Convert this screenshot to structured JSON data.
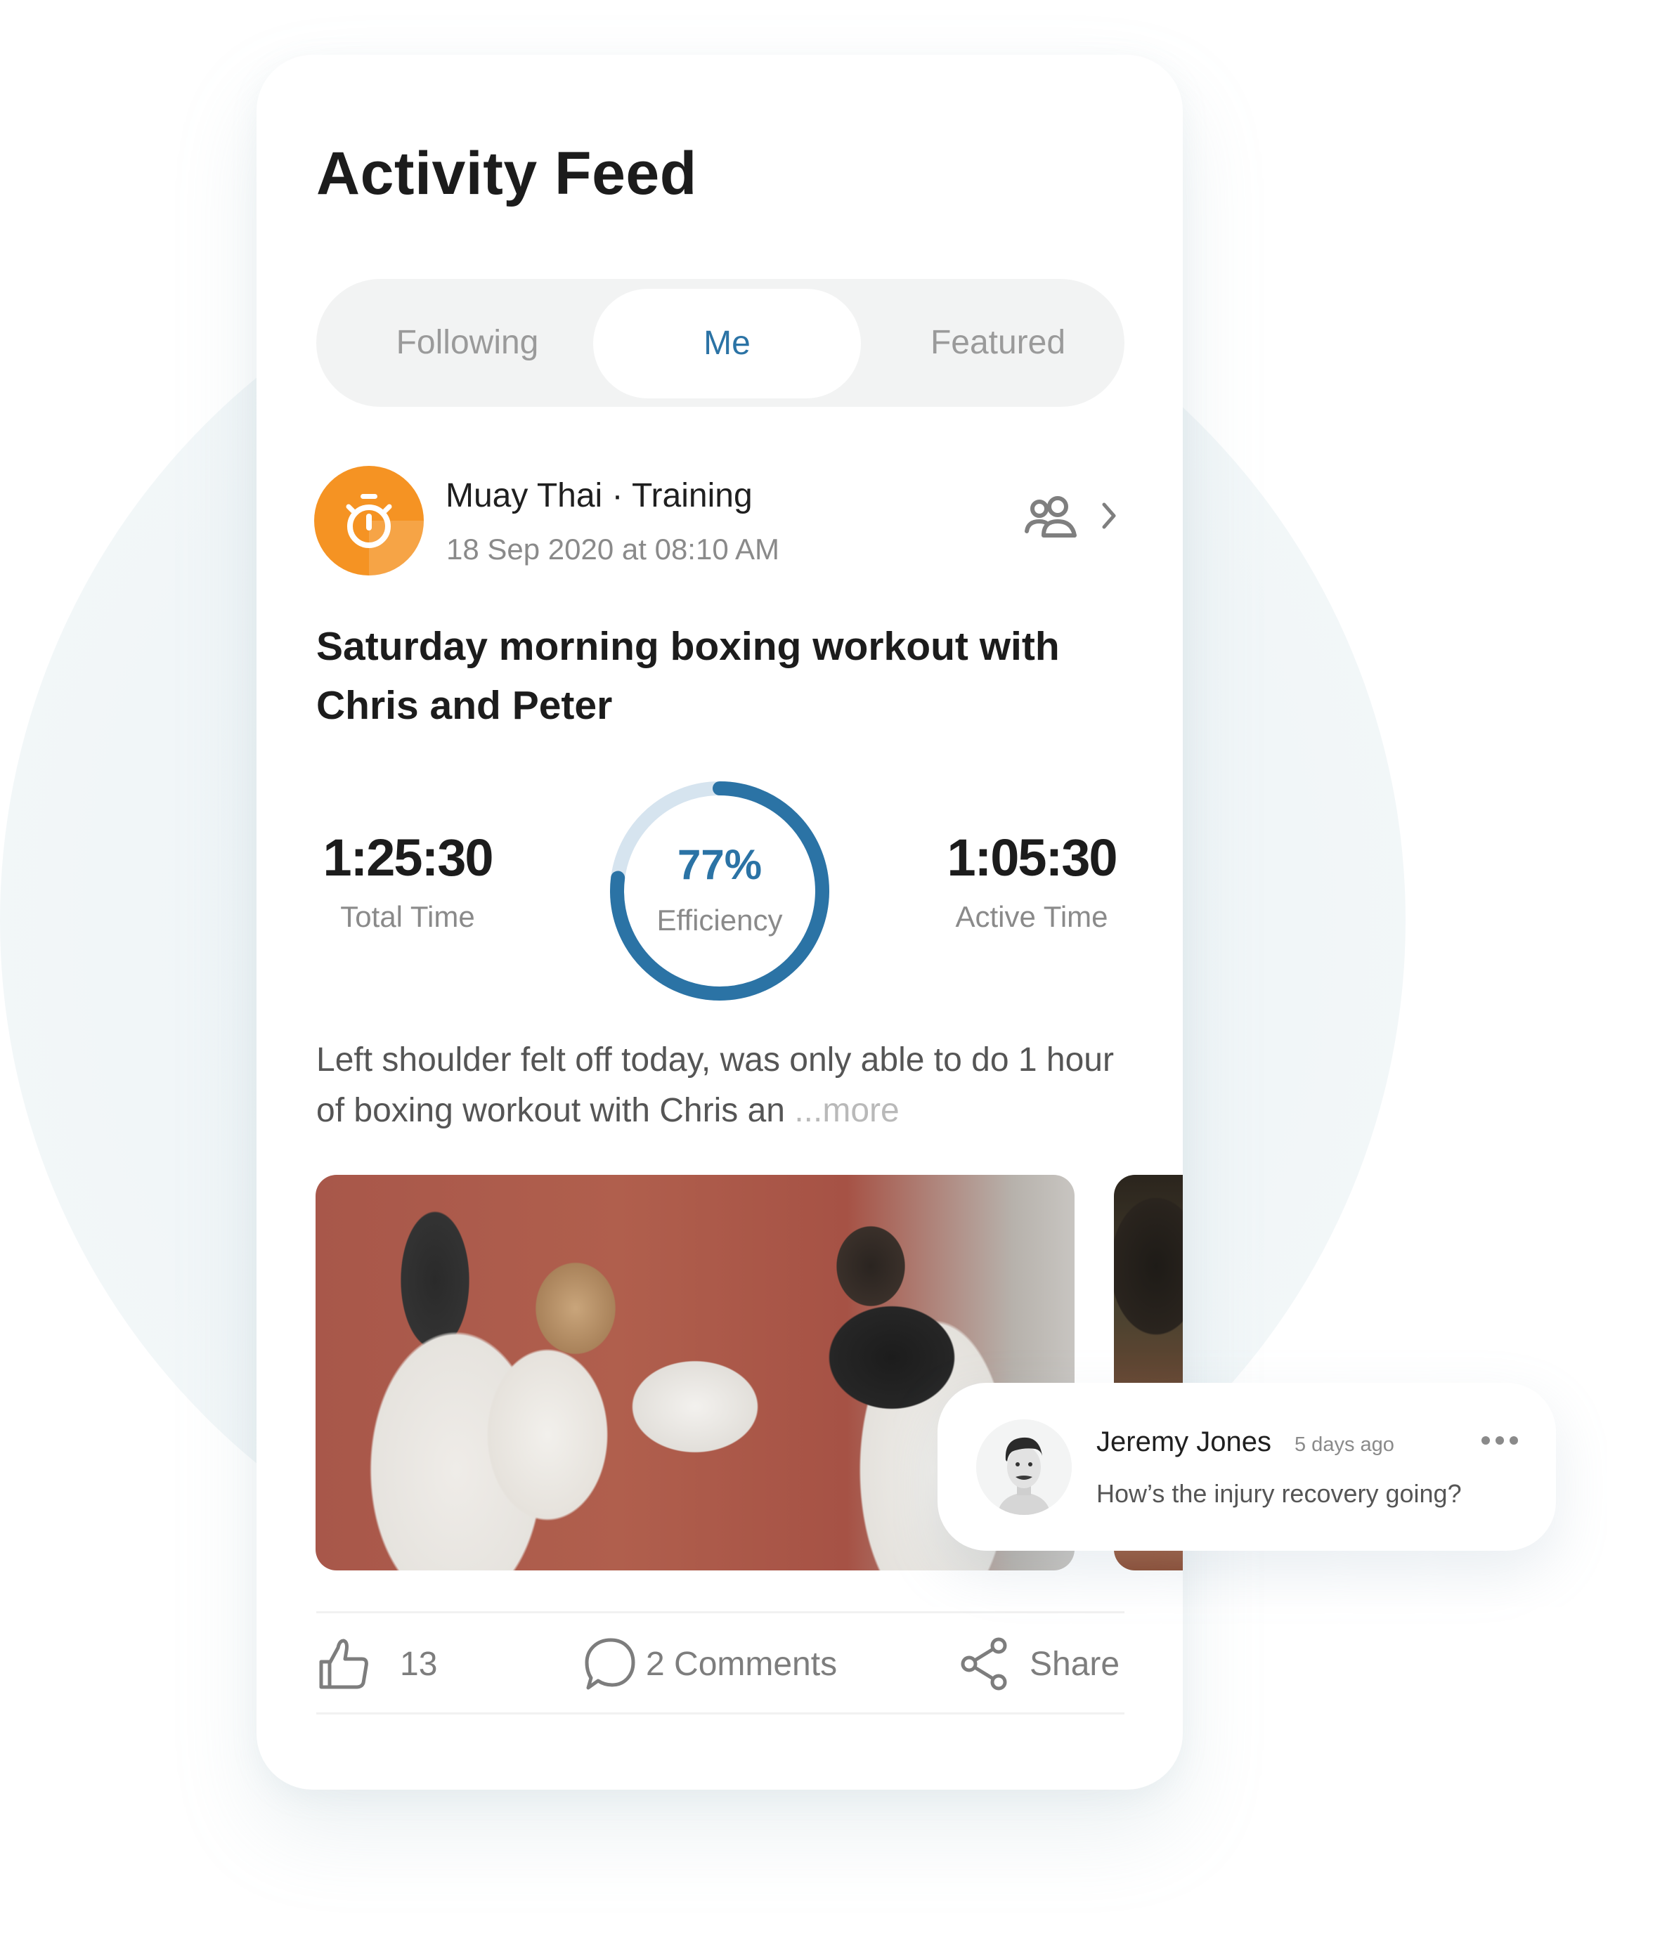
{
  "header": {
    "title": "Activity Feed"
  },
  "tabs": [
    {
      "label": "Following",
      "active": false
    },
    {
      "label": "Me",
      "active": true
    },
    {
      "label": "Featured",
      "active": false
    }
  ],
  "activity": {
    "icon": "stopwatch-icon",
    "type": "Muay Thai · Training",
    "date": "18 Sep 2020 at 08:10 AM",
    "participants_icon": "group-icon",
    "title": "Saturday morning boxing workout with Chris and Peter",
    "stats": {
      "total_time": {
        "value": "1:25:30",
        "label": "Total Time"
      },
      "efficiency": {
        "value": "77%",
        "label": "Efficiency",
        "fraction": 0.77
      },
      "active_time": {
        "value": "1:05:30",
        "label": "Active Time"
      }
    },
    "description": "Left shoulder felt off today, was only able to do 1 hour of boxing workout with Chris an",
    "more_label": "...more",
    "photos": [
      "boxing-photo-1",
      "boxing-photo-2"
    ]
  },
  "actions": {
    "likes": "13",
    "comments": "2 Comments",
    "share": "Share"
  },
  "comment": {
    "author": "Jeremy Jones",
    "time": "5 days ago",
    "text": "How’s the injury recovery going?"
  },
  "colors": {
    "accent": "#2b73a5",
    "accent_light": "#d6e4ef",
    "activity_orange": "#f59323",
    "text_dark": "#1c1c1c",
    "text_muted": "#8a8a8a"
  }
}
